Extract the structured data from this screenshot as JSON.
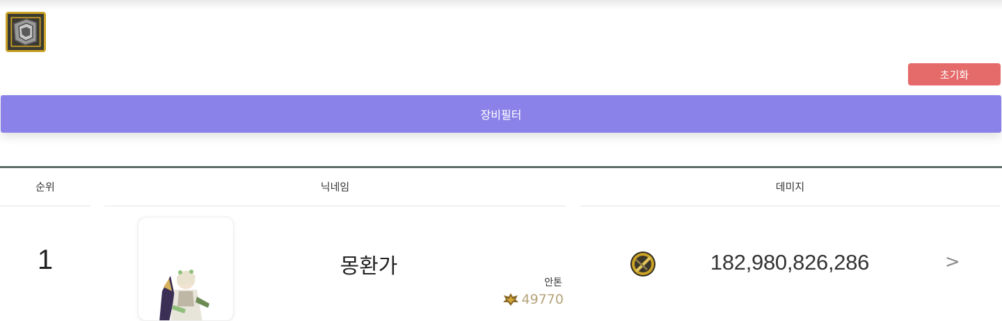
{
  "filter": {
    "reset_label": "초기화",
    "equip_filter_label": "장비필터",
    "equip_icon": "gear-equipment-icon"
  },
  "table": {
    "headers": {
      "rank": "순위",
      "nickname": "닉네임",
      "damage": "데미지"
    },
    "rows": [
      {
        "rank": "1",
        "nickname": "몽환가",
        "world": "안톤",
        "union_level": "49770",
        "damage": "182,980,826,286",
        "avatar_icon": "character-avatar",
        "weapon_icon": "weapon-icon",
        "detail_label": ">"
      }
    ]
  },
  "colors": {
    "accent": "#8a82e8",
    "reset": "#e56a6a",
    "divider": "#5f6d68",
    "union_text": "#b5a37a"
  }
}
